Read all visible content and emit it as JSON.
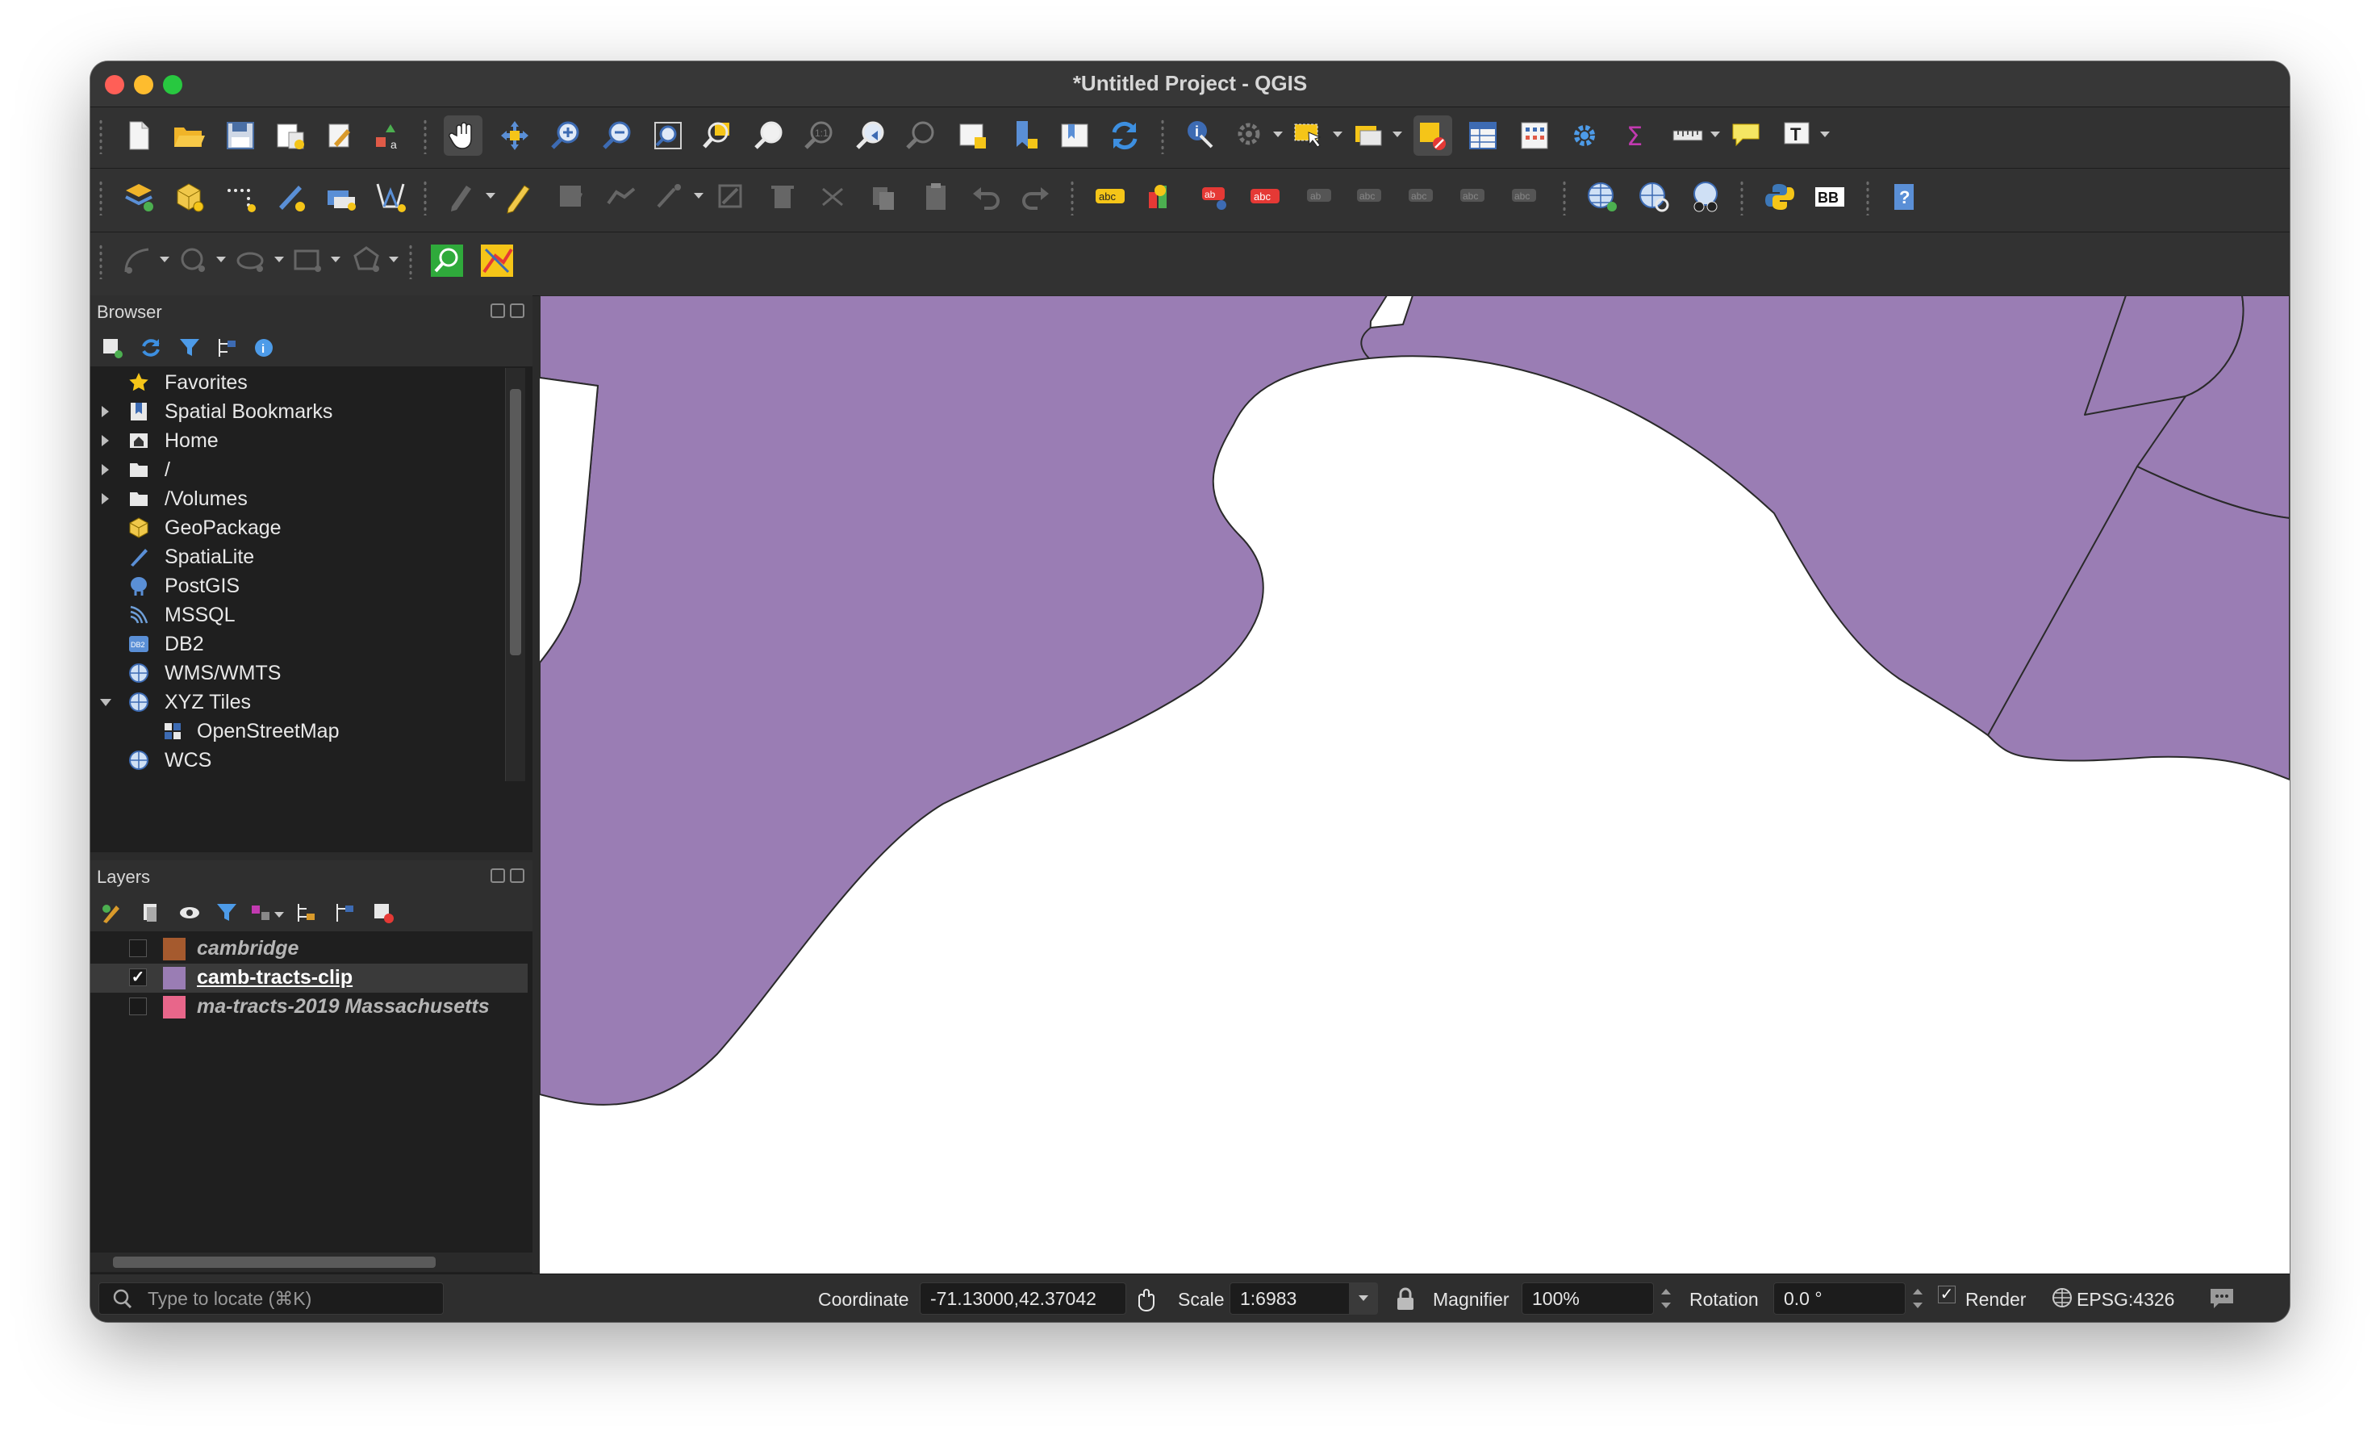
{
  "window": {
    "title": "*Untitled Project - QGIS"
  },
  "browser": {
    "title": "Browser",
    "items": [
      {
        "label": "Favorites",
        "icon": "star-icon",
        "expandable": false
      },
      {
        "label": "Spatial Bookmarks",
        "icon": "bookmark-icon",
        "expandable": true
      },
      {
        "label": "Home",
        "icon": "home-icon",
        "expandable": true
      },
      {
        "label": "/",
        "icon": "folder-icon",
        "expandable": true
      },
      {
        "label": "/Volumes",
        "icon": "folder-icon",
        "expandable": true
      },
      {
        "label": "GeoPackage",
        "icon": "geopackage-icon",
        "expandable": false
      },
      {
        "label": "SpatiaLite",
        "icon": "spatialite-icon",
        "expandable": false
      },
      {
        "label": "PostGIS",
        "icon": "postgis-icon",
        "expandable": false
      },
      {
        "label": "MSSQL",
        "icon": "mssql-icon",
        "expandable": false
      },
      {
        "label": "DB2",
        "icon": "db2-icon",
        "expandable": false
      },
      {
        "label": "WMS/WMTS",
        "icon": "globe-icon",
        "expandable": false
      },
      {
        "label": "XYZ Tiles",
        "icon": "globe-icon",
        "expanded": true
      },
      {
        "label": "OpenStreetMap",
        "icon": "tile-icon",
        "child": true
      },
      {
        "label": "WCS",
        "icon": "globe-icon",
        "expandable": false
      }
    ]
  },
  "layers": {
    "title": "Layers",
    "items": [
      {
        "label": "cambridge",
        "checked": false,
        "color": "#a55a2e"
      },
      {
        "label": "camb-tracts-clip",
        "checked": true,
        "color": "#9a7db4",
        "selected": true
      },
      {
        "label": "ma-tracts-2019 Massachusetts",
        "checked": false,
        "color": "#e8668a"
      }
    ]
  },
  "status": {
    "locate_placeholder": "Type to locate (⌘K)",
    "coordinate_label": "Coordinate",
    "coordinate_value": "-71.13000,42.37042",
    "scale_label": "Scale",
    "scale_value": "1:6983",
    "magnifier_label": "Magnifier",
    "magnifier_value": "100%",
    "rotation_label": "Rotation",
    "rotation_value": "0.0 °",
    "render_label": "Render",
    "render_checked": true,
    "crs_label": "EPSG:4326"
  },
  "map": {
    "fill_color": "#9a7db4",
    "stroke_color": "#2a2a2a"
  }
}
